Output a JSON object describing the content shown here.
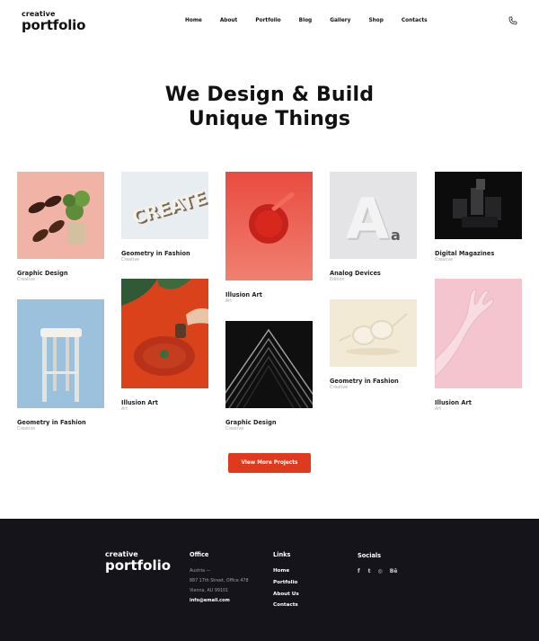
{
  "header": {
    "logo_line1": "creative",
    "logo_line2": "portfolio",
    "nav": [
      "Home",
      "About",
      "Portfolio",
      "Blog",
      "Gallery",
      "Shop",
      "Contacts"
    ]
  },
  "hero": {
    "line1": "We Design & Build",
    "line2": "Unique Things"
  },
  "projects": [
    {
      "title": "Graphic Design",
      "tag": "Creative"
    },
    {
      "title": "Geometry in Fashion",
      "tag": "Creative"
    },
    {
      "title": "Geometry in Fashion",
      "tag": "Creative"
    },
    {
      "title": "Illusion Art",
      "tag": "Art"
    },
    {
      "title": "Illusion Art",
      "tag": "Art"
    },
    {
      "title": "Graphic Design",
      "tag": "Creative"
    },
    {
      "title": "Analog Devices",
      "tag": "Edition"
    },
    {
      "title": "Geometry in Fashion",
      "tag": "Creative"
    },
    {
      "title": "Digital Magazines",
      "tag": "Creative"
    },
    {
      "title": "Illusion Art",
      "tag": "Art"
    }
  ],
  "cta": {
    "label": "View More Projects"
  },
  "footer": {
    "logo_line1": "creative",
    "logo_line2": "portfolio",
    "office_title": "Office",
    "office_lines": [
      "Austria —",
      "887 17th Street, Office 478",
      "Vienna, AU 99101"
    ],
    "email": "info@email.com",
    "links_title": "Links",
    "links": [
      "Home",
      "Portfolio",
      "About Us",
      "Contacts"
    ],
    "socials_title": "Socials",
    "socials": [
      "f",
      "t",
      "◎",
      "Bē"
    ]
  },
  "colors": {
    "accent": "#e03a1e",
    "footer_bg": "#15141b"
  }
}
